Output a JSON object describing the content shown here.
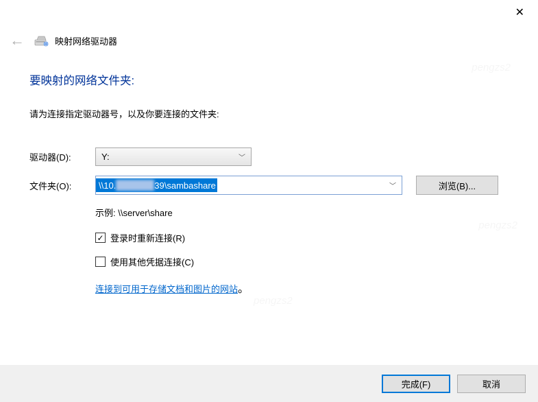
{
  "window": {
    "title": "映射网络驱动器"
  },
  "heading": "要映射的网络文件夹:",
  "instruction": "请为连接指定驱动器号，以及你要连接的文件夹:",
  "labels": {
    "drive": "驱动器(D):",
    "folder": "文件夹(O):"
  },
  "drive_value": "Y:",
  "folder_value_prefix": "\\\\10.",
  "folder_value_suffix": "39\\sambashare",
  "browse_label": "浏览(B)...",
  "example": "示例: \\\\server\\share",
  "checkboxes": {
    "reconnect": {
      "label": "登录时重新连接(R)",
      "checked": true
    },
    "credentials": {
      "label": "使用其他凭据连接(C)",
      "checked": false
    }
  },
  "link_text": "连接到可用于存储文档和图片的网站",
  "link_suffix": "。",
  "buttons": {
    "finish": "完成(F)",
    "cancel": "取消"
  },
  "watermark": "pengzs2"
}
